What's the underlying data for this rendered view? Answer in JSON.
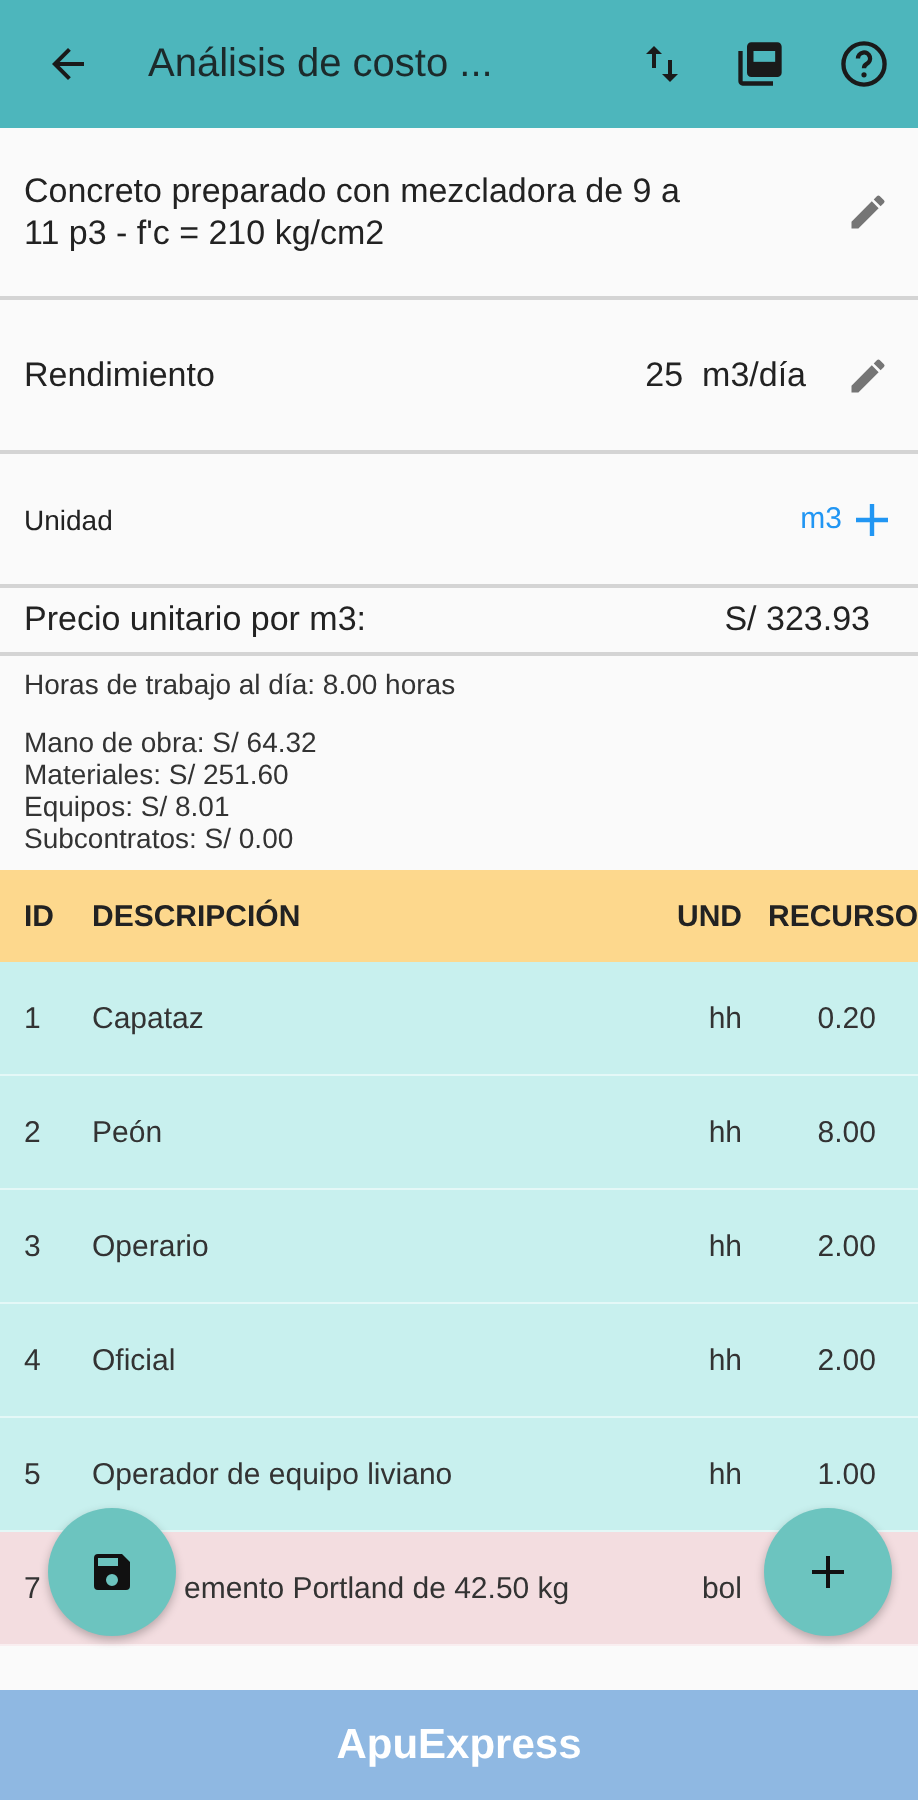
{
  "app_bar": {
    "title": "Análisis de costo ..."
  },
  "description": "Concreto preparado con mezcladora de 9 a 11 p3 - f'c = 210 kg/cm2",
  "rendimiento": {
    "label": "Rendimiento",
    "value": "25",
    "unit": "m3/día"
  },
  "unidad": {
    "label": "Unidad",
    "value": "m3"
  },
  "precio": {
    "label": "Precio unitario por m3:",
    "value": "S/ 323.93"
  },
  "horas": "Horas de trabajo al día: 8.00 horas",
  "subtotals": [
    "Mano de obra: S/ 64.32",
    "Materiales: S/ 251.60",
    "Equipos: S/ 8.01",
    "Subcontratos: S/ 0.00"
  ],
  "table": {
    "columns": [
      "ID",
      "DESCRIPCIÓN",
      "UND",
      "RECURSO"
    ],
    "rows": [
      {
        "id": "1",
        "description": "Capataz",
        "unit": "hh",
        "resource": "0.20",
        "color": "#c8f0ee"
      },
      {
        "id": "2",
        "description": "Peón",
        "unit": "hh",
        "resource": "8.00",
        "color": "#c8f0ee"
      },
      {
        "id": "3",
        "description": "Operario",
        "unit": "hh",
        "resource": "2.00",
        "color": "#c8f0ee"
      },
      {
        "id": "4",
        "description": "Oficial",
        "unit": "hh",
        "resource": "2.00",
        "color": "#c8f0ee"
      },
      {
        "id": "5",
        "description": "Operador de equipo liviano",
        "unit": "hh",
        "resource": "1.00",
        "color": "#c8f0ee"
      },
      {
        "id": "7",
        "description": "emento Portland de 42.50 kg",
        "unit": "bol",
        "color": "#f3dde0"
      }
    ]
  },
  "footer": {
    "title": "ApuExpress"
  }
}
